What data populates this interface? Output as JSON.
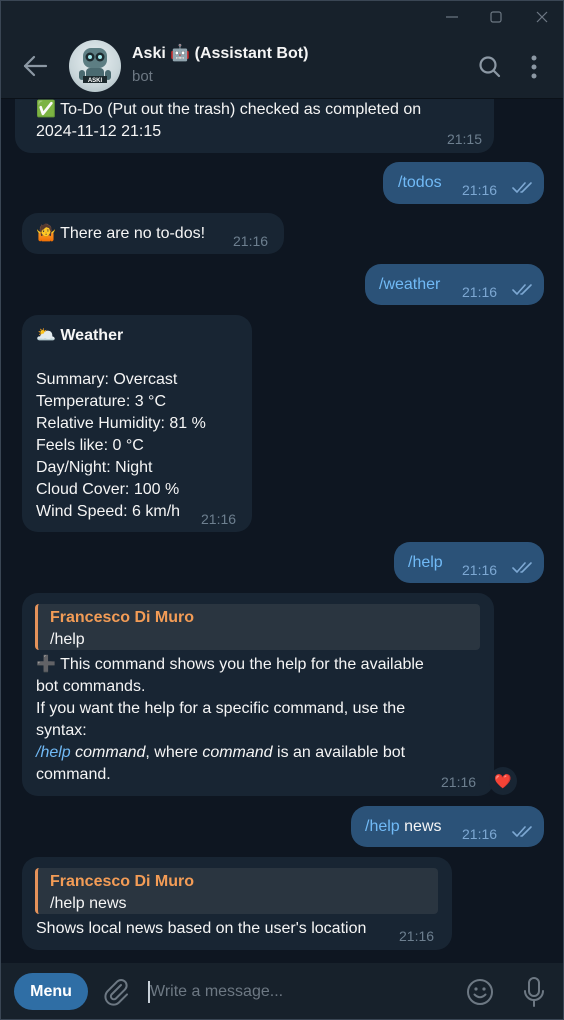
{
  "header": {
    "title": "Aski 🤖 (Assistant Bot)",
    "subtitle": "bot",
    "avatar_label": "ASKI"
  },
  "messages": {
    "m1": {
      "lines": [
        "✅ To-Do (Put out the trash) checked as completed on",
        "2024-11-12 21:15"
      ],
      "time": "21:15"
    },
    "m2": {
      "text": "/todos",
      "time": "21:16"
    },
    "m3": {
      "text": "🤷 There are no to-dos!",
      "time": "21:16"
    },
    "m4": {
      "text": "/weather",
      "time": "21:16"
    },
    "m5": {
      "title": "🌥️ Weather",
      "lines": [
        "Summary: Overcast",
        "Temperature: 3 °C",
        "Relative Humidity: 81 %",
        "Feels like: 0 °C",
        "Day/Night: Night",
        "Cloud Cover: 100 %",
        "Wind Speed: 6 km/h"
      ],
      "time": "21:16"
    },
    "m6": {
      "text": "/help",
      "time": "21:16"
    },
    "m7": {
      "quote_name": "Francesco Di Muro",
      "quote_text": "/help",
      "line1": "➕ This command shows you the help for the available",
      "line2": "bot commands.",
      "line3": "If you want the help for a specific command, use the",
      "line4": "syntax:",
      "l5_cmd": "/help",
      "l5_arg": "command",
      "l5_mid": ", where ",
      "l5_arg2": "command",
      "l5_end": " is an available bot",
      "line6": "command.",
      "time": "21:16",
      "reaction": "❤️"
    },
    "m8": {
      "cmd": "/help",
      "arg": " news",
      "time": "21:16"
    },
    "m9": {
      "quote_name": "Francesco Di Muro",
      "quote_text": "/help news",
      "text": "Shows local news based on the user's location",
      "time": "21:16"
    }
  },
  "composer": {
    "menu_label": "Menu",
    "placeholder": "Write a message..."
  },
  "colors": {
    "background": "#0e1621",
    "incoming_bubble": "#182533",
    "outgoing_bubble": "#2b5278",
    "accent": "#71baf6",
    "quote_accent": "#f39c56"
  }
}
